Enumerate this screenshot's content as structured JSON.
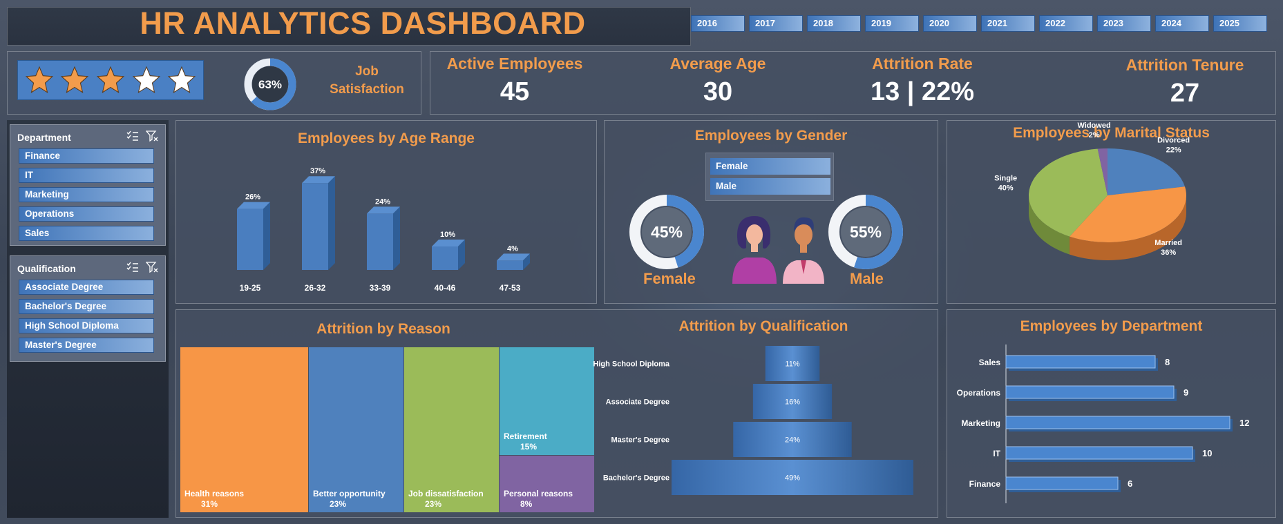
{
  "header": {
    "title": "HR ANALYTICS DASHBOARD",
    "years": [
      "2016",
      "2017",
      "2018",
      "2019",
      "2020",
      "2021",
      "2022",
      "2023",
      "2024",
      "2025"
    ]
  },
  "rating": {
    "stars_filled": 3,
    "stars_total": 5,
    "job_satisfaction_pct": 63,
    "job_satisfaction_text": "63%",
    "job_satisfaction_label": "Job Satisfaction"
  },
  "kpis": {
    "active_label": "Active Employees",
    "active_value": "45",
    "age_label": "Average Age",
    "age_value": "30",
    "attrition_label": "Attrition Rate",
    "attrition_value": "13 | 22%",
    "tenure_label": "Attrition Tenure",
    "tenure_value": "27"
  },
  "slicers": {
    "department_title": "Department",
    "department_items": [
      "Finance",
      "IT",
      "Marketing",
      "Operations",
      "Sales"
    ],
    "qualification_title": "Qualification",
    "qualification_items": [
      "Associate Degree",
      "Bachelor's Degree",
      "High School Diploma",
      "Master's Degree"
    ]
  },
  "gender": {
    "title": "Employees by Gender",
    "slicer_items": [
      "Female",
      "Male"
    ],
    "female_label": "Female",
    "female_pct": 45,
    "female_text": "45%",
    "male_label": "Male",
    "male_pct": 55,
    "male_text": "55%"
  },
  "colors": {
    "accent_orange": "#f29c4c",
    "bar_blue": "#4a7ebf",
    "green": "#9bbb59",
    "teal": "#4bacc6",
    "purple": "#8064a2",
    "panel_bg": "#465062"
  },
  "chart_data": [
    {
      "id": "age",
      "type": "bar",
      "title": "Employees by Age Range",
      "categories": [
        "19-25",
        "26-32",
        "33-39",
        "40-46",
        "47-53"
      ],
      "values": [
        26,
        37,
        24,
        10,
        4
      ],
      "labels": [
        "26%",
        "37%",
        "24%",
        "10%",
        "4%"
      ]
    },
    {
      "id": "marital",
      "type": "pie",
      "title": "Employees by Marital Status",
      "categories": [
        "Divorced",
        "Married",
        "Single",
        "Widowed"
      ],
      "values": [
        22,
        36,
        40,
        2
      ],
      "labels": [
        "22%",
        "36%",
        "40%",
        "2%"
      ],
      "colors": [
        "#4f81bd",
        "#f79646",
        "#9bbb59",
        "#8064a2"
      ]
    },
    {
      "id": "reason",
      "type": "treemap",
      "title": "Attrition by Reason",
      "categories": [
        "Health reasons",
        "Better opportunity",
        "Job dissatisfaction",
        "Retirement",
        "Personal reasons"
      ],
      "values": [
        31,
        23,
        23,
        15,
        8
      ],
      "labels": [
        "31%",
        "23%",
        "23%",
        "15%",
        "8%"
      ],
      "colors": [
        "#f79646",
        "#4f81bd",
        "#9bbb59",
        "#4bacc6",
        "#8064a2"
      ]
    },
    {
      "id": "qualification",
      "type": "funnel",
      "title": "Attrition by Qualification",
      "categories": [
        "High School Diploma",
        "Associate Degree",
        "Master's Degree",
        "Bachelor's Degree"
      ],
      "values": [
        11,
        16,
        24,
        49
      ],
      "labels": [
        "11%",
        "16%",
        "24%",
        "49%"
      ]
    },
    {
      "id": "department",
      "type": "bar",
      "orientation": "horizontal",
      "title": "Employees by Department",
      "categories": [
        "Sales",
        "Operations",
        "Marketing",
        "IT",
        "Finance"
      ],
      "values": [
        8,
        9,
        12,
        10,
        6
      ],
      "labels": [
        "8",
        "9",
        "12",
        "10",
        "6"
      ]
    }
  ]
}
